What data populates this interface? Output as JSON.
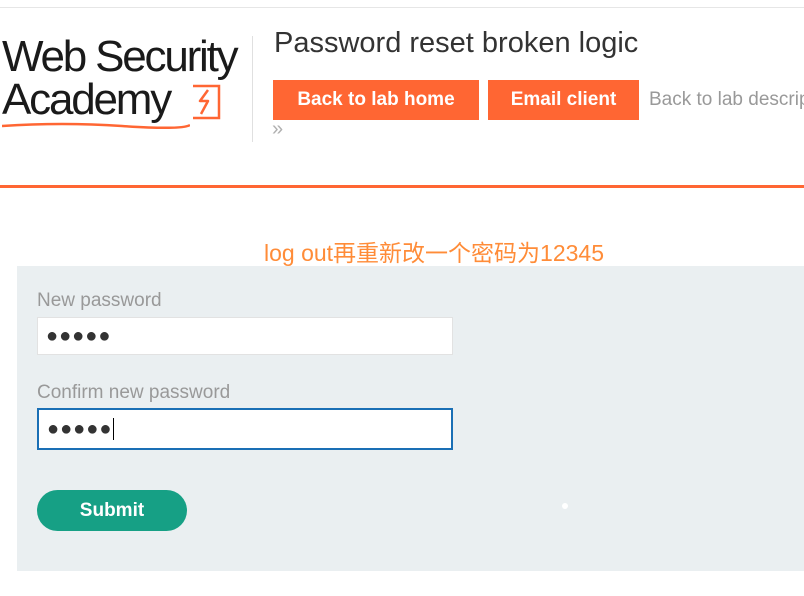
{
  "header": {
    "logo_line1": "Web Security",
    "logo_line2": "Academy",
    "lab_title": "Password reset broken logic",
    "back_to_lab_home": "Back to lab home",
    "email_client": "Email client",
    "back_to_lab_description": "Back to lab description",
    "chevron": "»"
  },
  "note": "log out再重新改一个密码为12345",
  "form": {
    "new_password_label": "New password",
    "new_password_value": "●●●●●",
    "confirm_password_label": "Confirm new password",
    "confirm_password_value": "●●●●●",
    "submit_label": "Submit"
  },
  "colors": {
    "accent": "#ff6633",
    "submit": "#16a085",
    "focus": "#1a6fb5",
    "note": "#ff8c38"
  }
}
